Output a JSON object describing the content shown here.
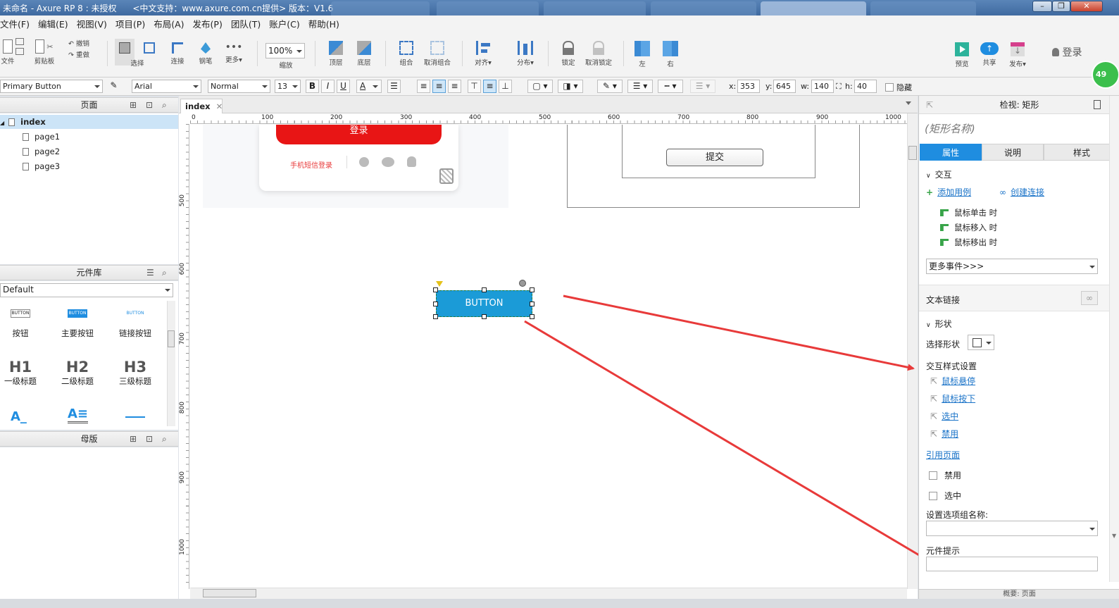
{
  "window": {
    "title": "未命名 - Axure RP 8 : 未授权      <中文支持：www.axure.com.cn提供> 版本：V1.6"
  },
  "menu": [
    "文件(F)",
    "编辑(E)",
    "视图(V)",
    "项目(P)",
    "布局(A)",
    "发布(P)",
    "团队(T)",
    "账户(C)",
    "帮助(H)"
  ],
  "toolbar": {
    "file": "文件",
    "clipboard": "剪贴板",
    "undo": "撤销",
    "redo": "重做",
    "select": "选择",
    "connect": "连接",
    "pen": "钢笔",
    "more": "更多▾",
    "zoom_value": "100%",
    "zoom_label": "缩放",
    "front": "顶层",
    "back": "底层",
    "group": "组合",
    "ungroup": "取消组合",
    "align": "对齐▾",
    "distribute": "分布▾",
    "lock": "锁定",
    "unlock": "取消锁定",
    "left": "左",
    "right": "右",
    "preview": "预览",
    "share": "共享",
    "publish": "发布▾",
    "login": "登录",
    "badge": "49"
  },
  "format": {
    "style": "Primary Button",
    "font": "Arial",
    "weight": "Normal",
    "size": "13",
    "bold": "B",
    "italic": "I",
    "underline": "U",
    "textcolor": "A",
    "x_label": "x:",
    "x": "353",
    "y_label": "y:",
    "y": "645",
    "w_label": "w:",
    "w": "140",
    "h_label": "h:",
    "h": "40",
    "hidden": "隐藏"
  },
  "pages": {
    "title": "页面",
    "root": "index",
    "children": [
      "page1",
      "page2",
      "page3"
    ]
  },
  "library": {
    "title": "元件库",
    "selected": "Default",
    "widgets": [
      {
        "icon": "BUTTON",
        "label": "按钮"
      },
      {
        "icon": "BUTTON",
        "label": "主要按钮"
      },
      {
        "icon": "BUTTON",
        "label": "链接按钮"
      },
      {
        "icon": "H1",
        "label": "一级标题"
      },
      {
        "icon": "H2",
        "label": "二级标题"
      },
      {
        "icon": "H3",
        "label": "三级标题"
      }
    ]
  },
  "masters": {
    "title": "母版"
  },
  "canvas": {
    "tab": "index",
    "ruler_h": [
      "0",
      "100",
      "200",
      "300",
      "400",
      "500",
      "600",
      "700",
      "800",
      "900",
      "1000"
    ],
    "ruler_v": [
      "500",
      "600",
      "700",
      "800",
      "900",
      "1000"
    ],
    "login_btn": "登录",
    "sms_login": "手机短信登录",
    "submit": "提交",
    "button_label": "BUTTON"
  },
  "inspector": {
    "header": "检视: 矩形",
    "name_placeholder": "(矩形名称)",
    "tabs": [
      "属性",
      "说明",
      "样式"
    ],
    "interaction": "交互",
    "add_case": "添加用例",
    "create_link": "创建连接",
    "events": [
      "鼠标单击 时",
      "鼠标移入 时",
      "鼠标移出 时"
    ],
    "more_events": "更多事件>>>",
    "text_link": "文本链接",
    "shape": "形状",
    "select_shape": "选择形状",
    "interaction_style": "交互样式设置",
    "styles": [
      "鼠标悬停",
      "鼠标按下",
      "选中",
      "禁用"
    ],
    "ref_page": "引用页面",
    "disabled": "禁用",
    "selected": "选中",
    "group_name": "设置选项组名称:",
    "tooltip": "元件提示",
    "bottom": "概要: 页面"
  },
  "colors": {
    "accent": "#1f8de0",
    "red_btn": "#e81515",
    "arrow": "#e83a3a",
    "selected_btn": "#1b9bd7"
  }
}
